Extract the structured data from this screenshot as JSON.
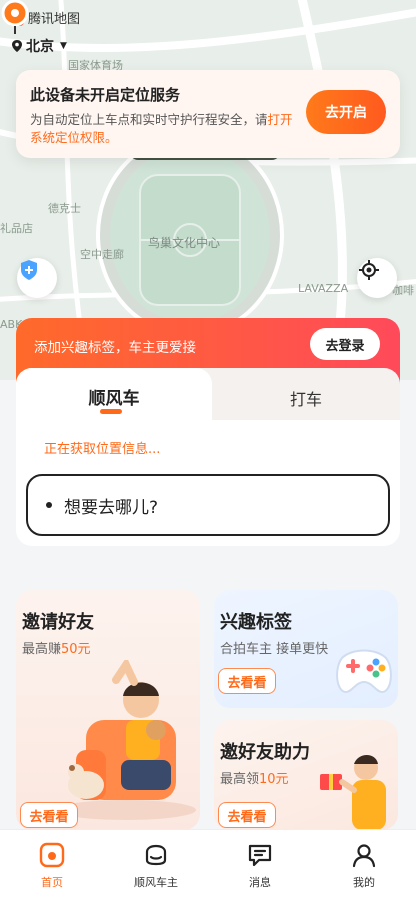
{
  "app": {
    "name": "腾讯地图"
  },
  "location": {
    "city": "北京"
  },
  "map": {
    "labels": [
      "国家体育场",
      "德克士",
      "礼品店",
      "空中走廊",
      "鸟巢文化中心",
      "LAVAZZA",
      "咖啡",
      "ABK"
    ]
  },
  "location_banner": {
    "title": "此设备未开启定位服务",
    "desc": "为自动定位上车点和实时守护行程安全，请",
    "link": "打开系统定位权限。",
    "button": "去开启"
  },
  "promo": {
    "text": "添加兴趣标签，车主更爱接",
    "login": "去登录"
  },
  "tabs": [
    {
      "label": "顺风车"
    },
    {
      "label": "打车"
    }
  ],
  "ride": {
    "status": "正在获取位置信息...",
    "destination_placeholder": "想要去哪儿?"
  },
  "cards": {
    "invite": {
      "title": "邀请好友",
      "sub_prefix": "最高赚",
      "sub_value": "50元",
      "button": "去看看"
    },
    "interest": {
      "title": "兴趣标签",
      "sub": "合拍车主 接单更快",
      "button": "去看看"
    },
    "help": {
      "title": "邀好友助力",
      "sub_prefix": "最高领",
      "sub_value": "10元",
      "button": "去看看"
    }
  },
  "bottom_nav": [
    {
      "label": "首页",
      "icon": "home-icon",
      "active": true
    },
    {
      "label": "顺风车主",
      "icon": "car-owner-icon",
      "active": false
    },
    {
      "label": "消息",
      "icon": "message-icon",
      "active": false
    },
    {
      "label": "我的",
      "icon": "profile-icon",
      "active": false
    }
  ],
  "colors": {
    "accent": "#ff6a1a",
    "promo_start": "#ff6a2a",
    "promo_end": "#ff4a5a"
  }
}
